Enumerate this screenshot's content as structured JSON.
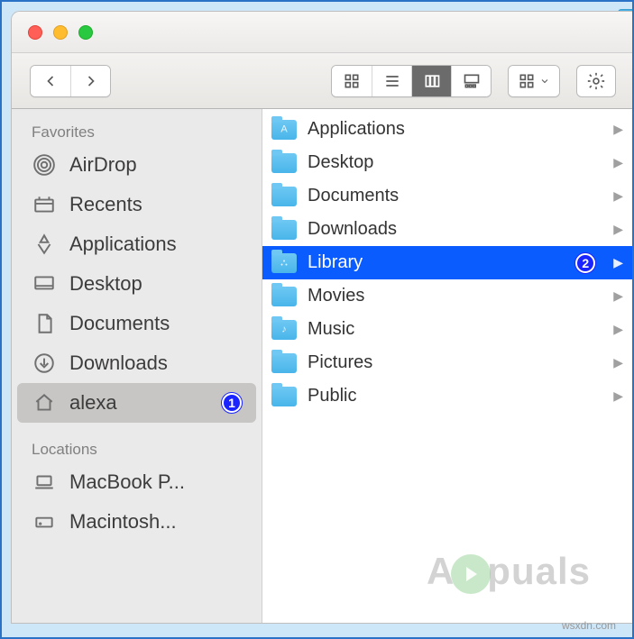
{
  "sidebar": {
    "sections": [
      {
        "header": "Favorites",
        "items": [
          {
            "label": "AirDrop",
            "icon": "airdrop",
            "selected": false
          },
          {
            "label": "Recents",
            "icon": "recents",
            "selected": false
          },
          {
            "label": "Applications",
            "icon": "applications",
            "selected": false
          },
          {
            "label": "Desktop",
            "icon": "desktop",
            "selected": false
          },
          {
            "label": "Documents",
            "icon": "documents",
            "selected": false
          },
          {
            "label": "Downloads",
            "icon": "downloads",
            "selected": false
          },
          {
            "label": "alexa",
            "icon": "home",
            "selected": true,
            "badge": "1"
          }
        ]
      },
      {
        "header": "Locations",
        "items": [
          {
            "label": "MacBook P...",
            "icon": "laptop",
            "selected": false
          },
          {
            "label": "Macintosh...",
            "icon": "disk",
            "selected": false
          }
        ]
      }
    ]
  },
  "column": {
    "items": [
      {
        "label": "Applications",
        "glyph": "A"
      },
      {
        "label": "Desktop",
        "glyph": ""
      },
      {
        "label": "Documents",
        "glyph": ""
      },
      {
        "label": "Downloads",
        "glyph": ""
      },
      {
        "label": "Library",
        "glyph": "⛬",
        "selected": true,
        "badge": "2"
      },
      {
        "label": "Movies",
        "glyph": ""
      },
      {
        "label": "Music",
        "glyph": "♪"
      },
      {
        "label": "Pictures",
        "glyph": ""
      },
      {
        "label": "Public",
        "glyph": ""
      }
    ]
  },
  "watermark": {
    "prefix": "A",
    "suffix": "puals"
  },
  "credit": "wsxdn.com"
}
